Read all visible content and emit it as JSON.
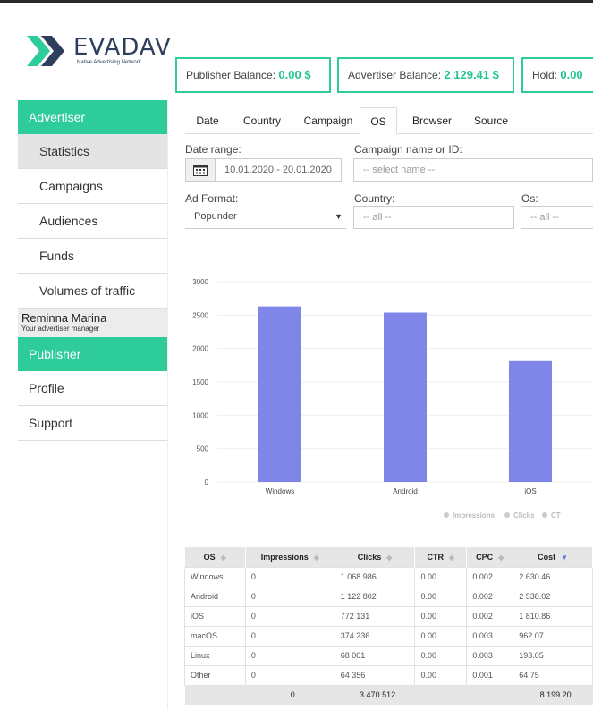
{
  "brand": {
    "name": "EVADAV",
    "tagline": "Native Advertising Network"
  },
  "balances": [
    {
      "label": "Publisher Balance:",
      "value": "0.00 $"
    },
    {
      "label": "Advertiser Balance:",
      "value": "2 129.41 $"
    },
    {
      "label": "Hold:",
      "value": "0.00"
    }
  ],
  "sidebar": {
    "advertiser": "Advertiser",
    "items": [
      "Statistics",
      "Campaigns",
      "Audiences",
      "Funds",
      "Volumes of traffic"
    ],
    "manager_name": "Reminna Marina",
    "manager_role": "Your advertiser manager",
    "publisher": "Publisher",
    "profile": "Profile",
    "support": "Support"
  },
  "tabs": [
    "Date",
    "Country",
    "Campaign",
    "OS",
    "Browser",
    "Source"
  ],
  "filters": {
    "date_range_label": "Date range:",
    "date_range_value": "10.01.2020 - 20.01.2020",
    "campaign_label": "Campaign name or ID:",
    "campaign_placeholder": "-- select name --",
    "ad_format_label": "Ad Format:",
    "ad_format_value": "Popunder",
    "country_label": "Country:",
    "country_value": "-- all --",
    "os_label": "Os:",
    "os_value": "-- all --"
  },
  "colors": {
    "accent": "#2ecc9a",
    "bar": "#7f86e8"
  },
  "chart_data": {
    "type": "bar",
    "categories": [
      "Windows",
      "Android",
      "iOS"
    ],
    "values": [
      2630,
      2538,
      1811
    ],
    "ylim": [
      0,
      3000
    ],
    "yticks": [
      0,
      500,
      1000,
      1500,
      2000,
      2500,
      3000
    ],
    "legend": [
      "Impressions",
      "Clicks",
      "CT"
    ],
    "legend_position": "bottom-right"
  },
  "table": {
    "headers": [
      "OS",
      "Impressions",
      "Clicks",
      "CTR",
      "CPC",
      "Cost"
    ],
    "rows": [
      [
        "Windows",
        "0",
        "1 068 986",
        "0.00",
        "0.002",
        "2 630.46"
      ],
      [
        "Android",
        "0",
        "1 122 802",
        "0.00",
        "0.002",
        "2 538.02"
      ],
      [
        "iOS",
        "0",
        "772 131",
        "0.00",
        "0.002",
        "1 810.86"
      ],
      [
        "macOS",
        "0",
        "374 236",
        "0.00",
        "0.003",
        "962.07"
      ],
      [
        "Linux",
        "0",
        "68 001",
        "0.00",
        "0.003",
        "193.05"
      ],
      [
        "Other",
        "0",
        "64 356",
        "0.00",
        "0.001",
        "64.75"
      ]
    ],
    "totals": [
      "",
      "0",
      "3 470 512",
      "",
      "",
      "8 199.20"
    ]
  }
}
